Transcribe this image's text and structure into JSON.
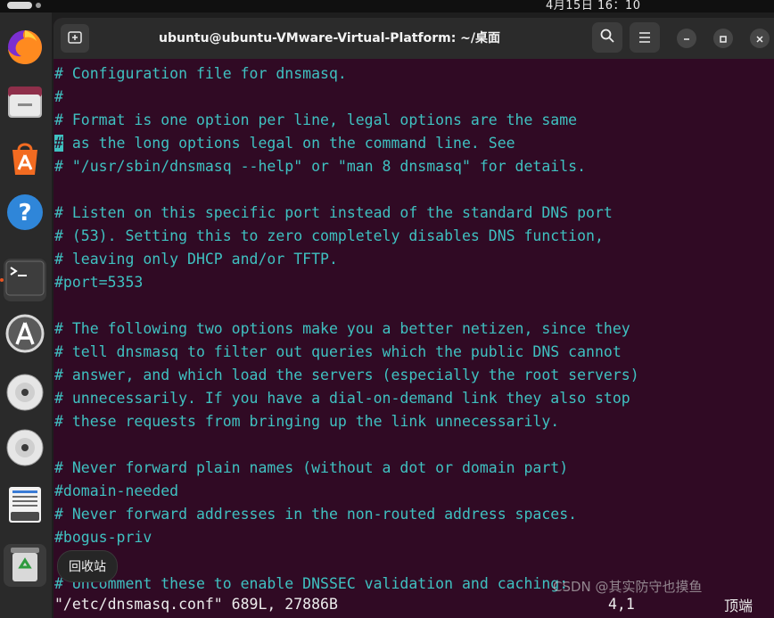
{
  "topbar": {
    "clock": "4月15日  16：10"
  },
  "tooltip": {
    "label": "回收站"
  },
  "window": {
    "title": "ubuntu@ubuntu-VMware-Virtual-Platform: ~/桌面"
  },
  "dock": {
    "items": [
      {
        "name": "firefox-icon"
      },
      {
        "name": "files-icon"
      },
      {
        "name": "app-center-icon"
      },
      {
        "name": "help-icon"
      },
      {
        "name": "terminal-icon"
      },
      {
        "name": "software-updater-icon"
      },
      {
        "name": "disc-icon-1"
      },
      {
        "name": "disc-icon-2"
      },
      {
        "name": "text-editor-icon"
      },
      {
        "name": "trash-icon"
      }
    ]
  },
  "editor": {
    "cursor_char": "#",
    "line2_rest": " as the long options legal on the command line. See",
    "lines": [
      "# Configuration file for dnsmasq.",
      "#",
      "# Format is one option per line, legal options are the same",
      "",
      "# \"/usr/sbin/dnsmasq --help\" or \"man 8 dnsmasq\" for details.",
      "",
      "# Listen on this specific port instead of the standard DNS port",
      "# (53). Setting this to zero completely disables DNS function,",
      "# leaving only DHCP and/or TFTP.",
      "#port=5353",
      "",
      "# The following two options make you a better netizen, since they",
      "# tell dnsmasq to filter out queries which the public DNS cannot",
      "# answer, and which load the servers (especially the root servers)",
      "# unnecessarily. If you have a dial-on-demand link they also stop",
      "# these requests from bringing up the link unnecessarily.",
      "",
      "# Never forward plain names (without a dot or domain part)",
      "#domain-needed",
      "# Never forward addresses in the non-routed address spaces.",
      "#bogus-priv",
      "",
      "# Uncomment these to enable DNSSEC validation and caching:"
    ],
    "status_file": "\"/etc/dnsmasq.conf\" 689L, 27886B",
    "status_position": "4,1",
    "status_top": "顶端"
  },
  "watermark": "CSDN @其实防守也摸鱼"
}
